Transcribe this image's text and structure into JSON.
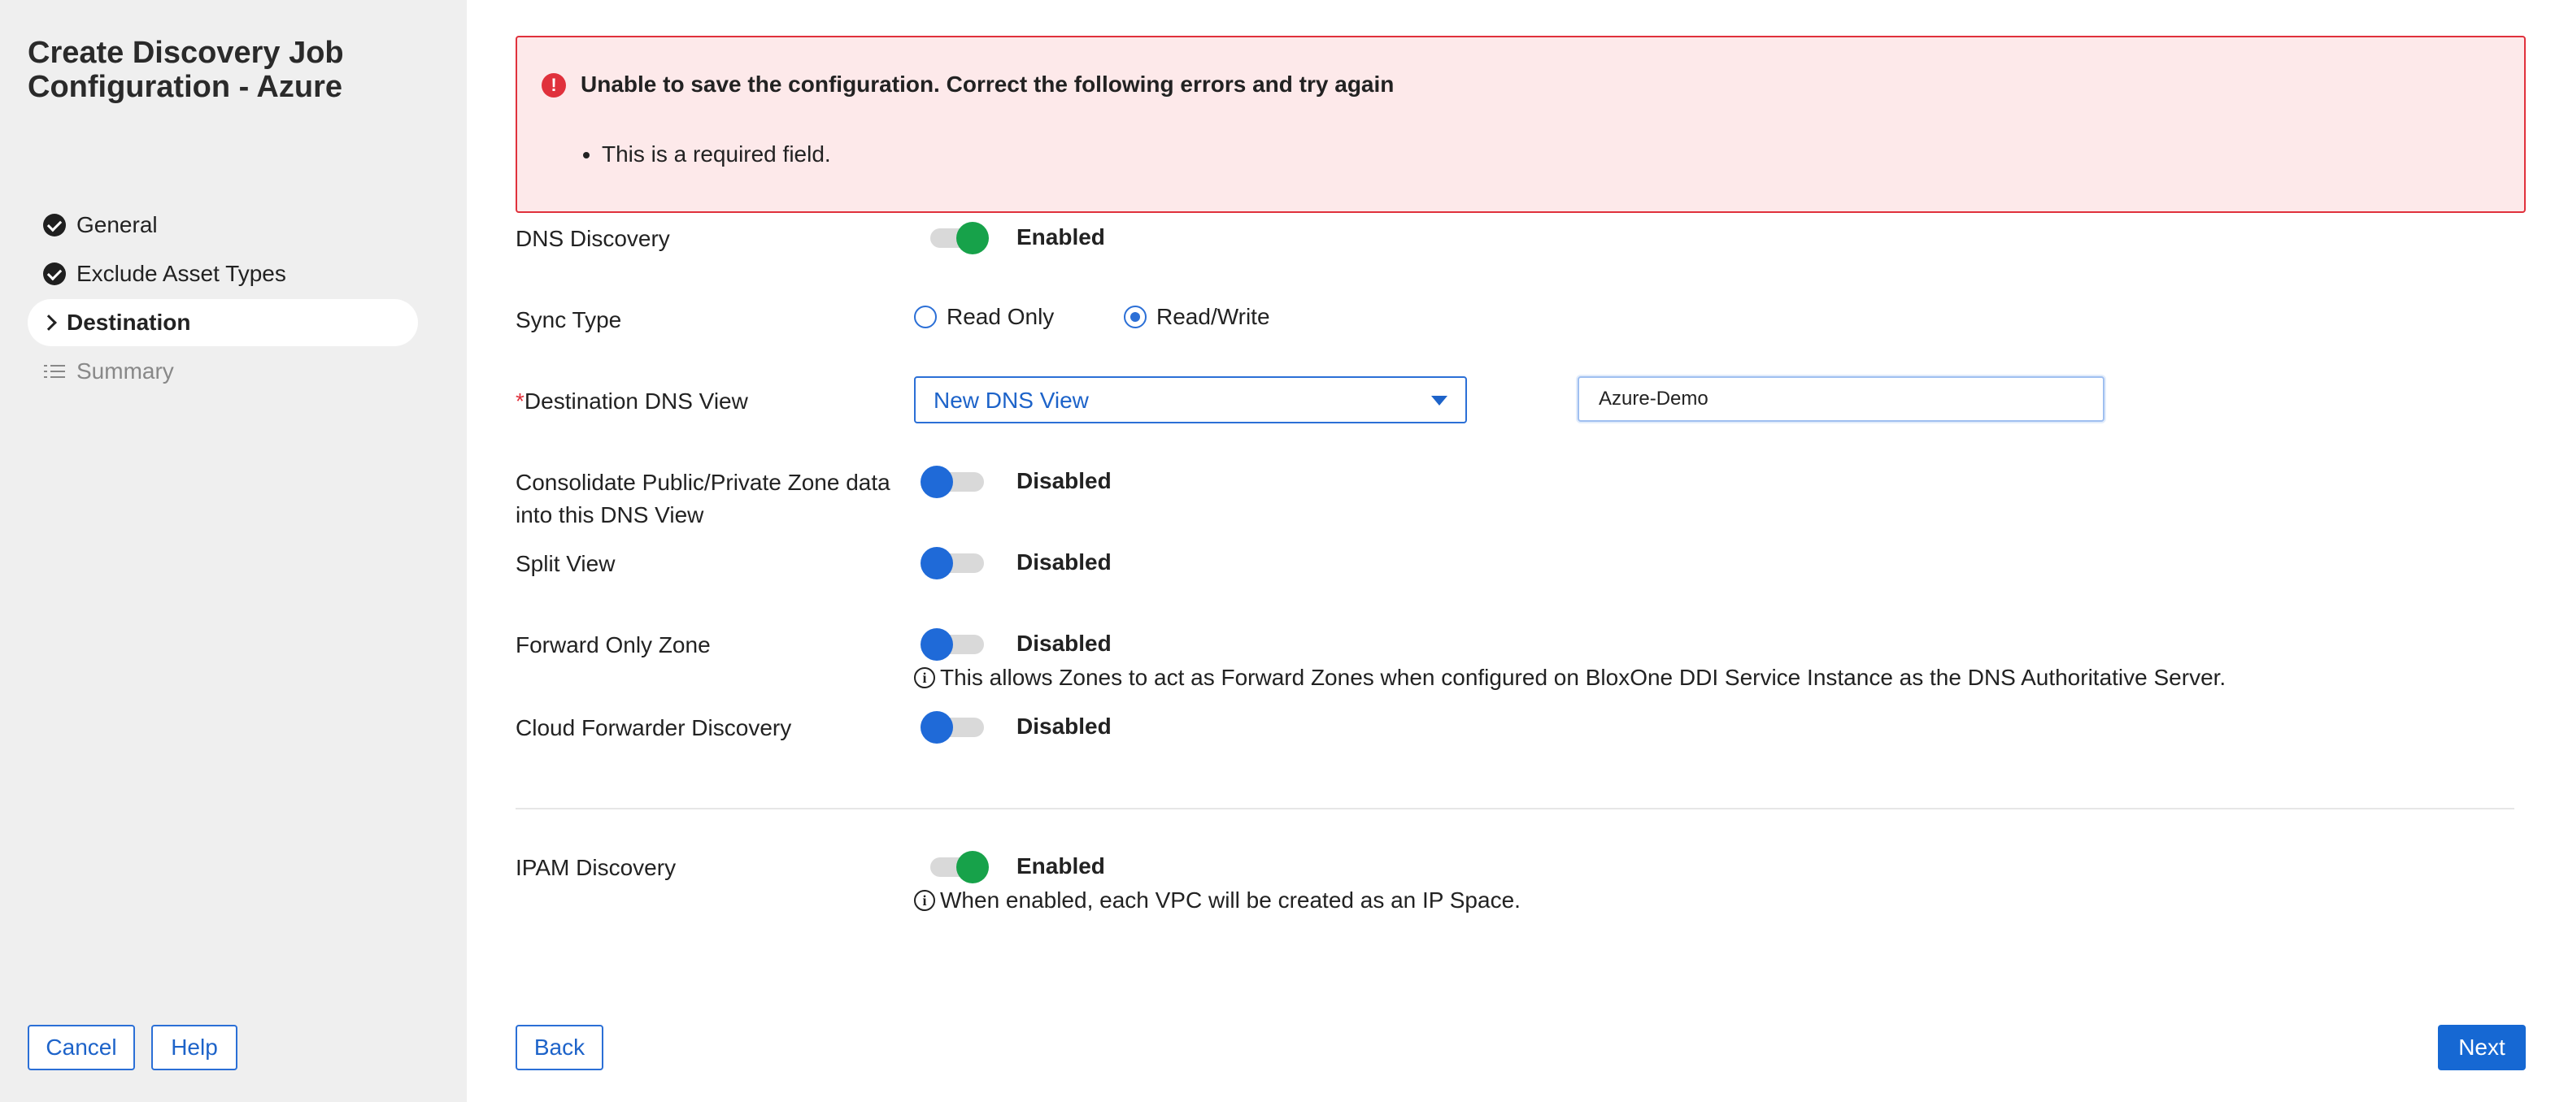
{
  "sidebar": {
    "title": "Create Discovery Job Configuration - Azure",
    "steps": [
      {
        "label": "General",
        "status": "complete"
      },
      {
        "label": "Exclude Asset Types",
        "status": "complete"
      },
      {
        "label": "Destination",
        "status": "active"
      },
      {
        "label": "Summary",
        "status": "pending"
      }
    ],
    "cancel_label": "Cancel",
    "help_label": "Help"
  },
  "error": {
    "title": "Unable to save the configuration. Correct the following errors and try again",
    "items": [
      "This is a required field."
    ]
  },
  "form": {
    "dns_discovery": {
      "label": "DNS Discovery",
      "state": "Enabled"
    },
    "sync_type": {
      "label": "Sync Type",
      "options": [
        "Read Only",
        "Read/Write"
      ],
      "selected": "Read/Write"
    },
    "destination_dns_view": {
      "required_mark": "*",
      "label": "Destination DNS View",
      "selected": "New DNS View",
      "new_view_value": "Azure-Demo"
    },
    "consolidate": {
      "label_line1": "Consolidate Public/Private Zone data",
      "label_line2": "into this DNS View",
      "state": "Disabled"
    },
    "split_view": {
      "label": "Split View",
      "state": "Disabled"
    },
    "forward_only_zone": {
      "label": "Forward Only Zone",
      "state": "Disabled",
      "info": "This allows Zones to act as Forward Zones when configured on BloxOne DDI Service Instance as the DNS Authoritative Server."
    },
    "cloud_forwarder": {
      "label": "Cloud Forwarder Discovery",
      "state": "Disabled"
    },
    "ipam_discovery": {
      "label": "IPAM Discovery",
      "state": "Enabled",
      "info": "When enabled, each VPC will be created as an IP Space."
    }
  },
  "footer": {
    "back_label": "Back",
    "next_label": "Next"
  },
  "colors": {
    "primary": "#1668d3",
    "enabled_green": "#17a24a",
    "error_red": "#e0313c",
    "error_bg": "#fde9ea",
    "sidebar_bg": "#efefef"
  },
  "icons": [
    "check-circle-icon",
    "chevron-right-icon",
    "list-check-icon",
    "error-icon",
    "info-icon",
    "caret-down-icon"
  ]
}
